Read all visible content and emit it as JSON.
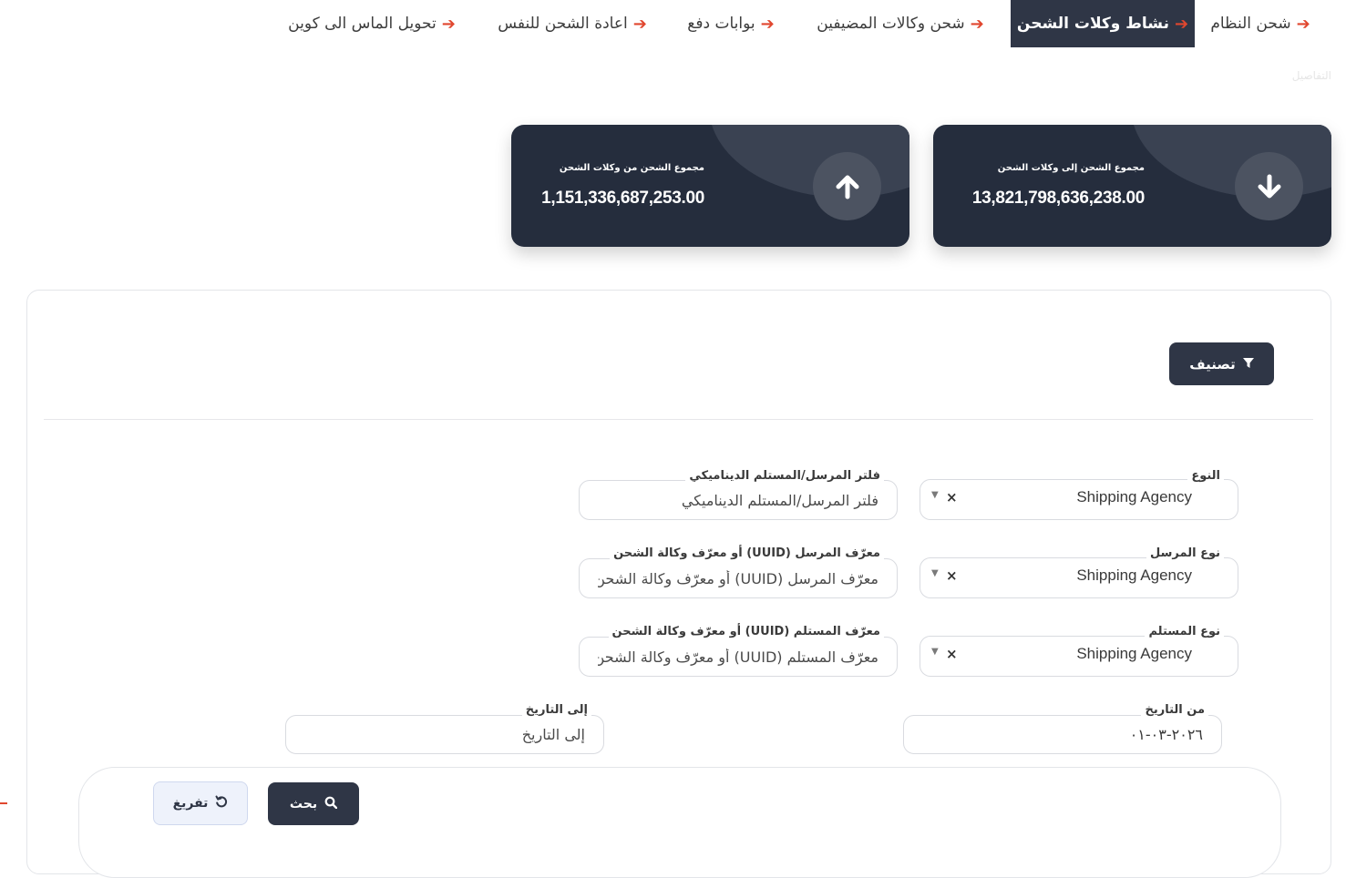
{
  "tabs": [
    {
      "label": "شحن النظام",
      "active": false
    },
    {
      "label": "نشاط وكلات الشحن",
      "active": true
    },
    {
      "label": "شحن وكالات المضيفين",
      "active": false
    },
    {
      "label": "بوابات دفع",
      "active": false
    },
    {
      "label": "اعادة الشحن للنفس",
      "active": false
    },
    {
      "label": "تحويل الماس الى كوين",
      "active": false
    }
  ],
  "breadcrumb": "التفاصيل",
  "cards": [
    {
      "label": "مجموع الشحن إلى وكلات الشحن",
      "value": "13,821,798,636,238.00",
      "icon": "arrow-down-icon"
    },
    {
      "label": "مجموع الشحن من وكلات الشحن",
      "value": "1,151,336,687,253.00",
      "icon": "arrow-up-icon"
    }
  ],
  "filter": {
    "toggle_label": "تصنيف",
    "type": {
      "label": "النوع",
      "value": "Shipping Agency"
    },
    "sender_type": {
      "label": "نوع المرسل",
      "value": "Shipping Agency"
    },
    "receiver_type": {
      "label": "نوع المستلم",
      "value": "Shipping Agency"
    },
    "dynamic": {
      "label": "فلتر المرسل/المستلم الديناميكي",
      "placeholder": "فلتر المرسل/المستلم الديناميكي"
    },
    "sender_id": {
      "label": "معرّف المرسل (UUID) أو معرّف وكالة الشحن",
      "placeholder": "معرّف المرسل (UUID) أو معرّف وكالة الشحن"
    },
    "receiver_id": {
      "label": "معرّف المستلم (UUID) أو معرّف وكالة الشحن",
      "placeholder": "معرّف المستلم (UUID) أو معرّف وكالة الشحن"
    },
    "from_date": {
      "label": "من التاريخ",
      "value": "٢٠٢٦-٠٣-٠١"
    },
    "to_date": {
      "label": "إلى التاريخ",
      "placeholder": "إلى التاريخ"
    }
  },
  "actions": {
    "search_label": "بحث",
    "reset_label": "تفريغ"
  },
  "colors": {
    "primary": "#2f3646",
    "accent": "#e0472f",
    "card": "#252d3d"
  }
}
